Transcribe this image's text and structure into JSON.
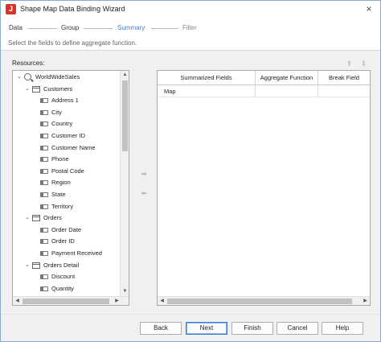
{
  "window": {
    "title": "Shape Map Data Binding Wizard",
    "icon": "jreport-app-icon",
    "icon_letter": "J",
    "close_glyph": "×"
  },
  "steps": [
    {
      "label": "Data",
      "state": "done"
    },
    {
      "label": "Group",
      "state": "done"
    },
    {
      "label": "Summary",
      "state": "active"
    },
    {
      "label": "Filter",
      "state": "pending"
    }
  ],
  "hint": "Select the fields to define aggregate function.",
  "resources": {
    "label": "Resources:",
    "tree": [
      {
        "label": "WorldWideSales",
        "level": 0,
        "icon": "search-icon",
        "expanded": true
      },
      {
        "label": "Customers",
        "level": 1,
        "icon": "table-icon",
        "expanded": true
      },
      {
        "label": "Address 1",
        "level": 2,
        "icon": "field-icon"
      },
      {
        "label": "City",
        "level": 2,
        "icon": "field-icon"
      },
      {
        "label": "Country",
        "level": 2,
        "icon": "field-icon"
      },
      {
        "label": "Customer ID",
        "level": 2,
        "icon": "field-icon"
      },
      {
        "label": "Customer Name",
        "level": 2,
        "icon": "field-icon"
      },
      {
        "label": "Phone",
        "level": 2,
        "icon": "field-icon"
      },
      {
        "label": "Postal Code",
        "level": 2,
        "icon": "field-icon"
      },
      {
        "label": "Region",
        "level": 2,
        "icon": "field-icon"
      },
      {
        "label": "State",
        "level": 2,
        "icon": "field-icon"
      },
      {
        "label": "Territory",
        "level": 2,
        "icon": "field-icon"
      },
      {
        "label": "Orders",
        "level": 1,
        "icon": "table-icon",
        "expanded": true
      },
      {
        "label": "Order Date",
        "level": 2,
        "icon": "field-icon"
      },
      {
        "label": "Order ID",
        "level": 2,
        "icon": "field-icon"
      },
      {
        "label": "Payment Received",
        "level": 2,
        "icon": "field-icon"
      },
      {
        "label": "Orders Detail",
        "level": 1,
        "icon": "table-icon",
        "expanded": true
      },
      {
        "label": "Discount",
        "level": 2,
        "icon": "field-icon"
      },
      {
        "label": "Quantity",
        "level": 2,
        "icon": "field-icon"
      }
    ]
  },
  "glyphs": {
    "expanded": "⌄",
    "up": "▲",
    "down": "▼",
    "left": "◀",
    "right": "▶",
    "move_right": "➡",
    "move_left": "⬅",
    "order_up": "⬆",
    "order_down": "⬇"
  },
  "summary_table": {
    "columns": [
      "Summarized Fields",
      "Aggregate Function",
      "Break Field"
    ],
    "rows": [
      [
        "Map",
        "",
        ""
      ]
    ]
  },
  "buttons": {
    "back": "Back",
    "next": "Next",
    "finish": "Finish",
    "cancel": "Cancel",
    "help": "Help"
  },
  "colors": {
    "active_step": "#4a7fc0",
    "primary_border": "#3c7fd1",
    "app_icon": "#d9342b"
  }
}
